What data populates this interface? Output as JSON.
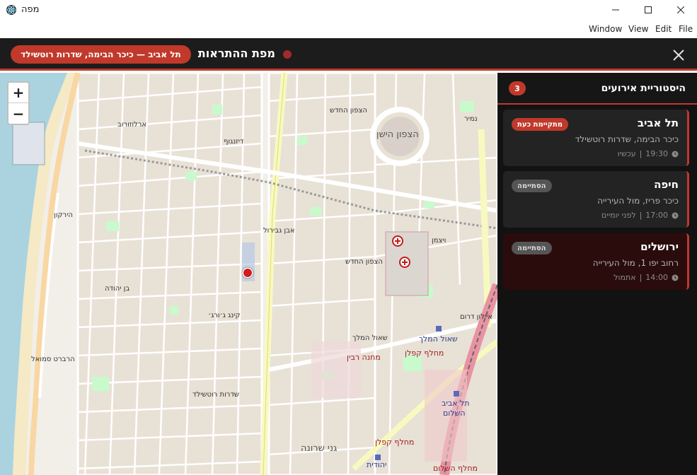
{
  "window": {
    "title": "מפה",
    "icon": "electron-icon"
  },
  "menu": {
    "file": "File",
    "edit": "Edit",
    "view": "View",
    "window": "Window"
  },
  "header": {
    "title": "מפת ההתראות",
    "location": "תל אביב — כיכר הבימה, שדרות רוטשילד",
    "accent_color": "#c0392b"
  },
  "map": {
    "zoom_in": "+",
    "zoom_out": "−",
    "labels": {
      "north_new": "הצפון החדש",
      "north_new_2": "הצפון החדש",
      "old_north": "הצפון הישן",
      "station_shaul": "שאול המלך",
      "interchange_kaplan": "מחלף קפלן",
      "interchange_kaplan_2": "מחלף קפלן",
      "rabin_camp": "מחנה רבין",
      "station_tlv": "תל אביב",
      "station_hashalom": "השלום",
      "yehudit": "יהודית",
      "sarona": "גני שרונה",
      "interchange_hashalom": "מחלף השלום",
      "ibn_gvirol": "אבן גבירול",
      "arlozorov": "ארלוזורוב",
      "dizengoff": "דיזנגוף",
      "rothschild": "שדרות רוטשילד",
      "ben_yehuda": "בן יהודה",
      "herbert_samuel": "הרברט סמואל",
      "hayarkon": "הירקון",
      "king_george": "קינג ג׳ורג׳",
      "shaul_hamelech_rd": "שאול המלך",
      "weizmann": "ויצמן",
      "namir": "נמיר",
      "ayalon": "איילון דרום"
    }
  },
  "sidebar": {
    "title": "היסטוריית אירועים",
    "count": "3",
    "events": [
      {
        "city": "תל אביב",
        "place": "כיכר הבימה, שדרות רוטשילד",
        "time": "19:30",
        "relative": "עכשיו",
        "status": "מתקיימת כעת",
        "status_type": "active"
      },
      {
        "city": "חיפה",
        "place": "כיכר פריז, מול העירייה",
        "time": "17:00",
        "relative": "לפני יומיים",
        "status": "הסתיימה",
        "status_type": "ended"
      },
      {
        "city": "ירושלים",
        "place": "רחוב יפו 1, מול העירייה",
        "time": "14:00",
        "relative": "אתמול",
        "status": "הסתיימה",
        "status_type": "ended"
      }
    ],
    "separator": "|"
  }
}
